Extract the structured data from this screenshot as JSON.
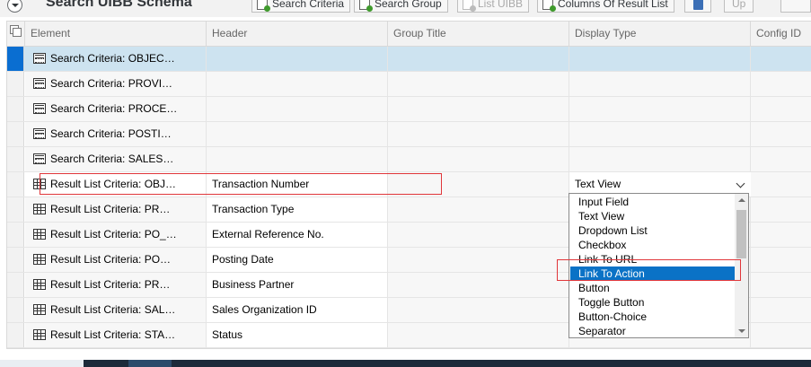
{
  "toolbar": {
    "title": "Search UIBB Schema",
    "buttons": [
      {
        "label": "Search Criteria",
        "disabled": false
      },
      {
        "label": "Search Group",
        "disabled": false
      },
      {
        "label": "List UIBB",
        "disabled": true
      },
      {
        "label": "Columns Of Result List",
        "disabled": false
      }
    ],
    "up_label": "Up"
  },
  "table": {
    "columns": [
      "Element",
      "Header",
      "Group Title",
      "Display Type",
      "Config ID"
    ],
    "rows": [
      {
        "element": "Search Criteria: OBJEC…",
        "header": "",
        "display_type": "",
        "icon": "criteria-icon"
      },
      {
        "element": "Search Criteria: PROVI…",
        "header": "",
        "display_type": "",
        "icon": "criteria-icon"
      },
      {
        "element": "Search Criteria: PROCE…",
        "header": "",
        "display_type": "",
        "icon": "criteria-icon"
      },
      {
        "element": "Search Criteria: POSTI…",
        "header": "",
        "display_type": "",
        "icon": "criteria-icon"
      },
      {
        "element": "Search Criteria: SALES…",
        "header": "",
        "display_type": "",
        "icon": "criteria-icon"
      },
      {
        "element": "Result List Criteria: OBJ…",
        "header": "Transaction Number",
        "display_type": "Text View",
        "icon": "list-icon"
      },
      {
        "element": "Result List Criteria: PR…",
        "header": "Transaction Type",
        "display_type": "",
        "icon": "list-icon"
      },
      {
        "element": "Result List Criteria: PO_…",
        "header": "External Reference No.",
        "display_type": "",
        "icon": "list-icon"
      },
      {
        "element": "Result List Criteria: PO…",
        "header": "Posting Date",
        "display_type": "",
        "icon": "list-icon"
      },
      {
        "element": "Result List Criteria: PR…",
        "header": "Business Partner",
        "display_type": "",
        "icon": "list-icon"
      },
      {
        "element": "Result List Criteria: SAL…",
        "header": "Sales Organization ID",
        "display_type": "",
        "icon": "list-icon"
      },
      {
        "element": "Result List Criteria: STA…",
        "header": "Status",
        "display_type": "",
        "icon": "list-icon"
      }
    ],
    "selected_row": 0
  },
  "display_type_select": {
    "value": "Text View",
    "options": [
      "Input Field",
      "Text View",
      "Dropdown List",
      "Checkbox",
      "Link To URL",
      "Link To Action",
      "Button",
      "Toggle Button",
      "Button-Choice",
      "Separator"
    ],
    "highlighted": "Link To Action"
  },
  "colors": {
    "selection_blue": "#0a6ed1",
    "selected_row_bg": "#cde3f0",
    "highlight_red": "#e0363a"
  }
}
